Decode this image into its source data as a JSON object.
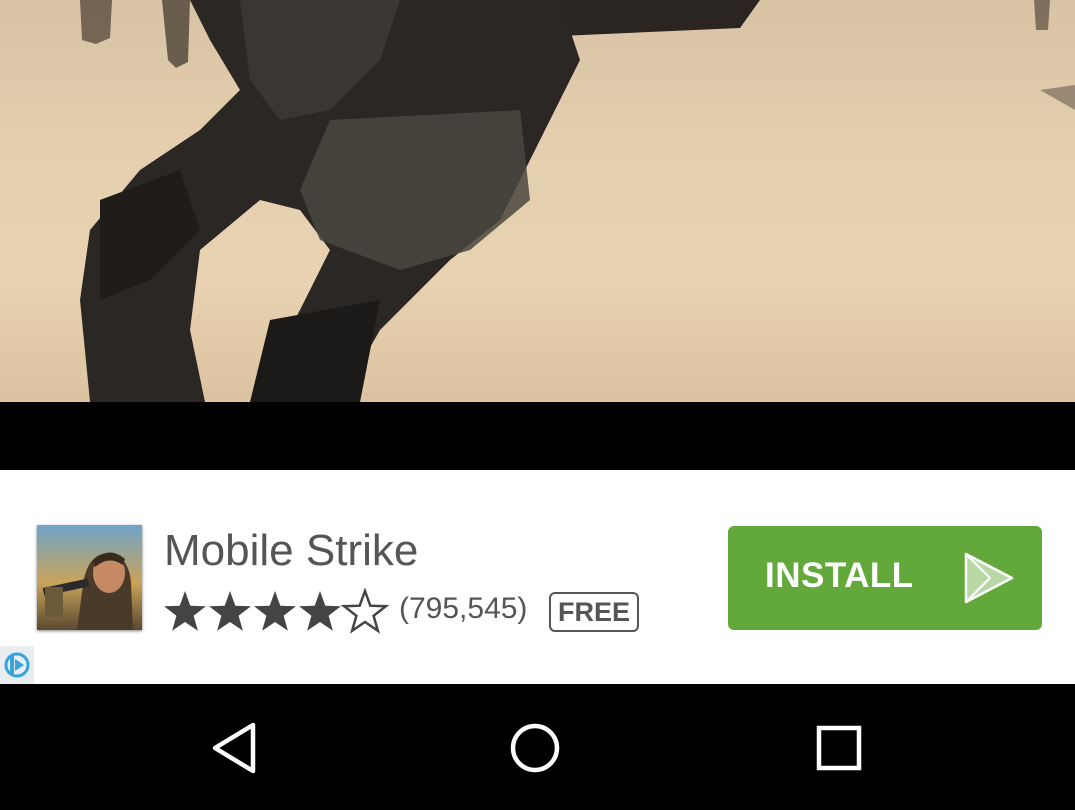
{
  "video": {
    "description_icon": "video-frame-soldier-running"
  },
  "ad": {
    "app_name": "Mobile Strike",
    "rating": 4,
    "rating_max": 5,
    "rating_count": "(795,545)",
    "price": "FREE",
    "install_label": "INSTALL",
    "colors": {
      "install_bg": "#62a83b",
      "text": "#555555"
    }
  },
  "navbar": {
    "back_icon": "back-triangle-icon",
    "home_icon": "home-circle-icon",
    "recents_icon": "recents-square-icon"
  }
}
